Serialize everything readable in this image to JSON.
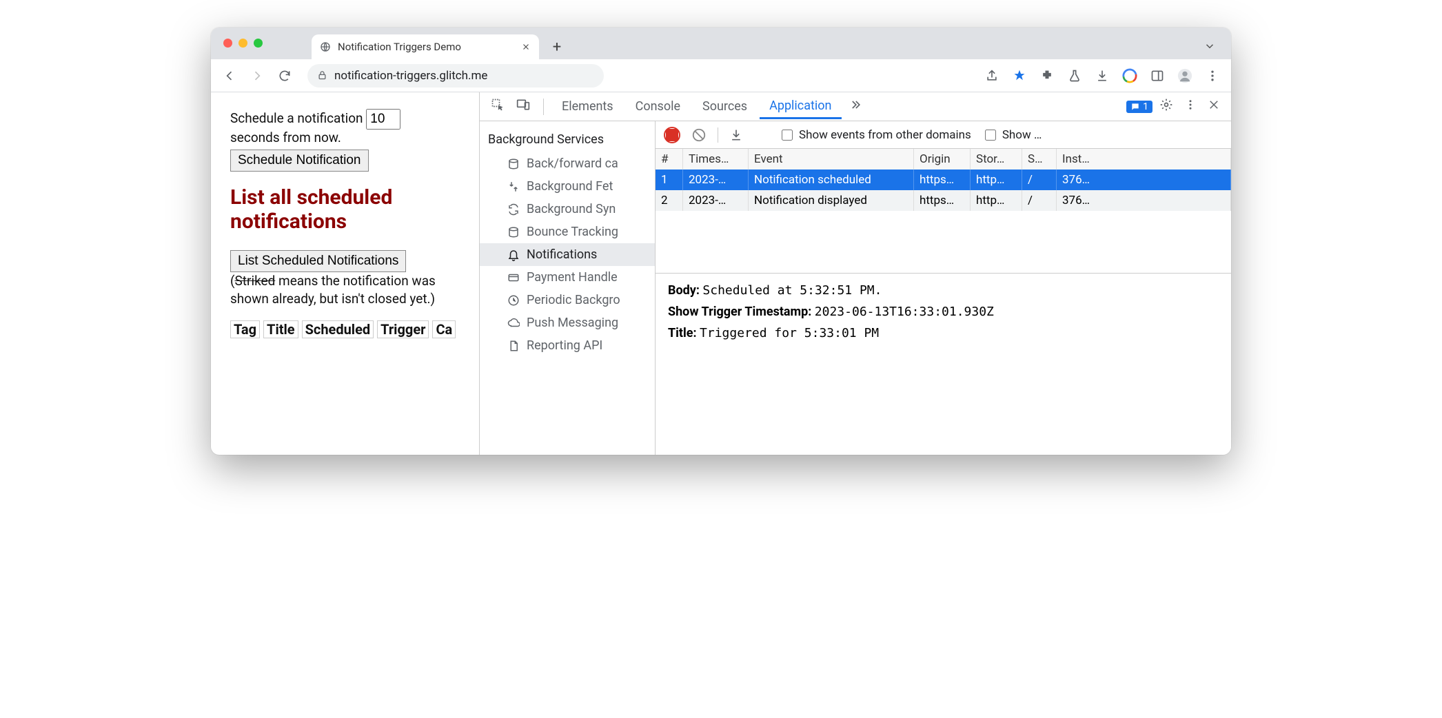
{
  "browser": {
    "tab_title": "Notification Triggers Demo",
    "url": "notification-triggers.glitch.me"
  },
  "page": {
    "schedule_prefix": "Schedule a notification",
    "schedule_value": "10",
    "schedule_suffix": "seconds from now.",
    "schedule_btn": "Schedule Notification",
    "heading": "List all scheduled notifications",
    "list_btn": "List Scheduled Notifications",
    "note_open": "(",
    "note_striked": "Striked",
    "note_rest": " means the notification was shown already, but isn't closed yet.)",
    "thead": [
      "Tag",
      "Title",
      "Scheduled",
      "Trigger",
      "Ca"
    ]
  },
  "devtools": {
    "tabs": [
      "Elements",
      "Console",
      "Sources",
      "Application"
    ],
    "active_tab": "Application",
    "issues_count": "1",
    "sidebar": {
      "category": "Background Services",
      "items": [
        "Back/forward ca",
        "Background Fet",
        "Background Syn",
        "Bounce Tracking",
        "Notifications",
        "Payment Handle",
        "Periodic Backgro",
        "Push Messaging",
        "Reporting API"
      ],
      "selected_index": 4
    },
    "toolbar": {
      "chk1": "Show events from other domains",
      "chk2": "Show …"
    },
    "columns": [
      "#",
      "Times…",
      "Event",
      "Origin",
      "Stor…",
      "S…",
      "Inst…"
    ],
    "rows": [
      {
        "n": "1",
        "ts": "2023-…",
        "event": "Notification scheduled",
        "origin": "https…",
        "storage": "http…",
        "scope": "/",
        "inst": "376…"
      },
      {
        "n": "2",
        "ts": "2023-…",
        "event": "Notification displayed",
        "origin": "https…",
        "storage": "http…",
        "scope": "/",
        "inst": "376…"
      }
    ],
    "selected_row": 0,
    "details": {
      "body_k": "Body:",
      "body_v": "Scheduled at 5:32:51 PM.",
      "ts_k": "Show Trigger Timestamp:",
      "ts_v": "2023-06-13T16:33:01.930Z",
      "title_k": "Title:",
      "title_v": "Triggered for 5:33:01 PM"
    }
  }
}
